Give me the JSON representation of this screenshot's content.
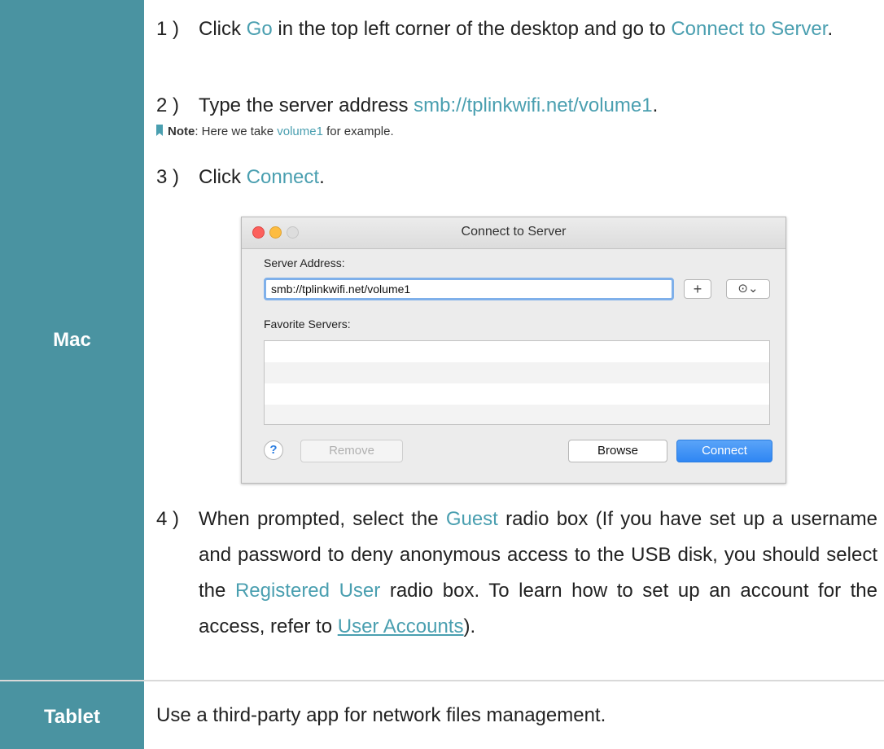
{
  "rows": {
    "mac": {
      "label": "Mac",
      "step1": {
        "num": "1 )",
        "t1": "Click ",
        "link_go": "Go",
        "t2": " in the top left corner of the desktop and go to ",
        "link_connect_server": "Connect to Server",
        "t3": "."
      },
      "step2": {
        "num": "2 )",
        "t1": "Type the server address ",
        "link_address": "smb://tplinkwifi.net/volume1",
        "t2": "."
      },
      "note": {
        "label": "Note",
        "t1": ": Here we take ",
        "link_volume": "volume1",
        "t2": " for example."
      },
      "step3": {
        "num": "3 )",
        "t1": "Click ",
        "link_connect": "Connect",
        "t2": "."
      },
      "step4": {
        "num": "4 )",
        "t1": "When prompted, select the ",
        "link_guest": "Guest",
        "t2": " radio box (If you have set up a username and password to deny anonymous access to the USB disk, you should select the ",
        "link_registered": "Registered User",
        "t3": " radio box. To learn how to set up an account for the access, refer to ",
        "link_user_accounts": "User Accounts",
        "t4": ")."
      }
    },
    "tablet": {
      "label": "Tablet",
      "text": "Use a third-party app for network files management."
    }
  },
  "dialog": {
    "title": "Connect to Server",
    "server_address_label": "Server Address:",
    "server_address_value": "smb://tplinkwifi.net/volume1",
    "add_button": "+",
    "recent_button": "⊙⌄",
    "favorite_servers_label": "Favorite Servers:",
    "help_button": "?",
    "remove_button": "Remove",
    "browse_button": "Browse",
    "connect_button": "Connect"
  },
  "colors": {
    "sidebar": "#4a93a1",
    "link": "#4a9fb0",
    "connect_button": "#2f86f3"
  }
}
